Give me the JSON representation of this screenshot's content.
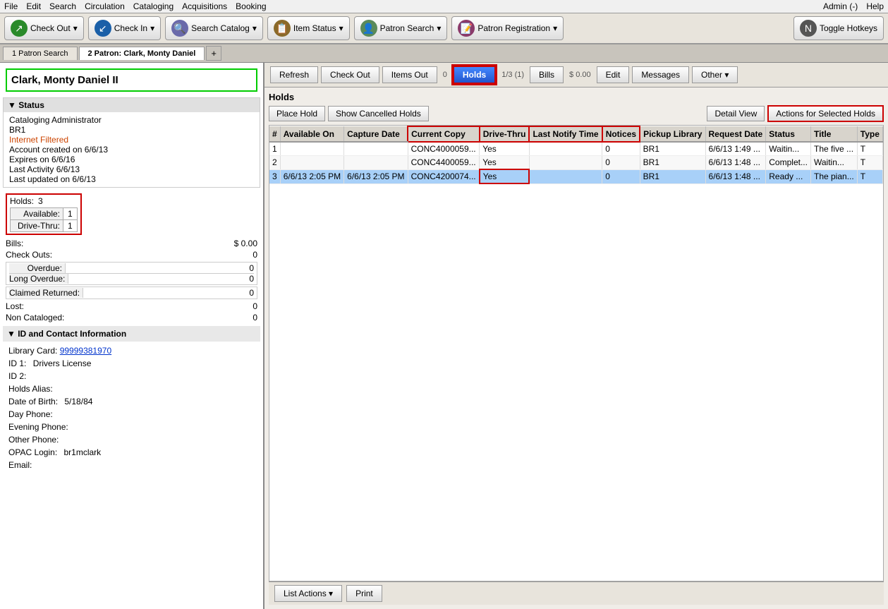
{
  "menubar": {
    "items": [
      "File",
      "Edit",
      "Search",
      "Circulation",
      "Cataloging",
      "Acquisitions",
      "Booking"
    ],
    "admin": "Admin (-)",
    "help": "Help"
  },
  "toolbar": {
    "checkout_label": "Check Out",
    "checkin_label": "Check In",
    "search_catalog_label": "Search Catalog",
    "item_status_label": "Item Status",
    "patron_search_label": "Patron Search",
    "patron_reg_label": "Patron Registration",
    "toggle_hotkeys_label": "Toggle Hotkeys"
  },
  "tabs": [
    {
      "label": "1 Patron Search",
      "active": false
    },
    {
      "label": "2 Patron: Clark, Monty Daniel",
      "active": true
    }
  ],
  "patient": {
    "name": "Clark, Monty Daniel II"
  },
  "patient_toolbar": {
    "refresh": "Refresh",
    "checkout": "Check Out",
    "items_out": "Items Out",
    "items_out_count": "0",
    "holds": "Holds",
    "holds_count": "1/3 (1)",
    "bills": "Bills",
    "bills_amount": "$ 0.00",
    "edit": "Edit",
    "messages": "Messages",
    "other": "Other"
  },
  "status": {
    "header": "▼ Status",
    "title": "Cataloging Administrator",
    "branch": "BR1",
    "internet": "Internet Filtered",
    "account_created": "Account created on 6/6/13",
    "expires": "Expires on 6/6/16",
    "last_activity": "Last Activity 6/6/13",
    "last_updated": "Last updated on 6/6/13",
    "holds_label": "Holds:",
    "holds_value": "3",
    "available_label": "Available:",
    "available_value": "1",
    "drive_thru_label": "Drive-Thru:",
    "drive_thru_value": "1",
    "bills_label": "Bills:",
    "bills_value": "$ 0.00",
    "checkouts_label": "Check Outs:",
    "checkouts_value": "0",
    "overdue_label": "Overdue:",
    "overdue_value": "0",
    "long_overdue_label": "Long Overdue:",
    "long_overdue_value": "0",
    "claimed_returned_label": "Claimed Returned:",
    "claimed_returned_value": "0",
    "lost_label": "Lost:",
    "lost_value": "0",
    "non_cataloged_label": "Non Cataloged:",
    "non_cataloged_value": "0"
  },
  "contact": {
    "header": "▼ ID and Contact Information",
    "library_card_label": "Library Card:",
    "library_card_value": "99999381970",
    "id1_label": "ID 1:",
    "id1_value": "Drivers License",
    "id2_label": "ID 2:",
    "id2_value": "",
    "holds_alias_label": "Holds Alias:",
    "holds_alias_value": "",
    "dob_label": "Date of Birth:",
    "dob_value": "5/18/84",
    "day_phone_label": "Day Phone:",
    "day_phone_value": "",
    "evening_phone_label": "Evening Phone:",
    "evening_phone_value": "",
    "other_phone_label": "Other Phone:",
    "other_phone_value": "",
    "opac_label": "OPAC Login:",
    "opac_value": "br1mclark",
    "email_label": "Email:",
    "email_value": ""
  },
  "holds": {
    "title": "Holds",
    "place_hold": "Place Hold",
    "show_cancelled": "Show Cancelled Holds",
    "detail_view": "Detail View",
    "actions_selected": "Actions for Selected Holds",
    "list_actions": "List Actions ▾",
    "print": "Print",
    "columns": [
      "#",
      "Available On",
      "Capture Date",
      "Current Copy",
      "Drive-Thru",
      "Last Notify Time",
      "Notices",
      "Pickup Library",
      "Request Date",
      "Status",
      "Title",
      "Type"
    ],
    "rows": [
      {
        "num": "1",
        "available_on": "",
        "capture_date": "",
        "current_copy": "CONC4000059...",
        "drive_thru": "Yes",
        "last_notify": "",
        "notices": "0",
        "pickup_lib": "BR1",
        "request_date": "6/6/13 1:49 ...",
        "status": "Waitin...",
        "title": "The five ...",
        "type": "T",
        "selected": false
      },
      {
        "num": "2",
        "available_on": "",
        "capture_date": "",
        "current_copy": "CONC4400059...",
        "drive_thru": "Yes",
        "last_notify": "",
        "notices": "0",
        "pickup_lib": "BR1",
        "request_date": "6/6/13 1:48 ...",
        "status": "Complet...",
        "title": "Waitin...",
        "type": "T",
        "selected": false
      },
      {
        "num": "3",
        "available_on": "6/6/13 2:05 PM",
        "capture_date": "6/6/13 2:05 PM",
        "current_copy": "CONC4200074...",
        "drive_thru": "Yes",
        "last_notify": "",
        "notices": "0",
        "pickup_lib": "BR1",
        "request_date": "6/6/13 1:48 ...",
        "status": "Ready ...",
        "title": "The pian...",
        "type": "T",
        "selected": true
      }
    ]
  }
}
